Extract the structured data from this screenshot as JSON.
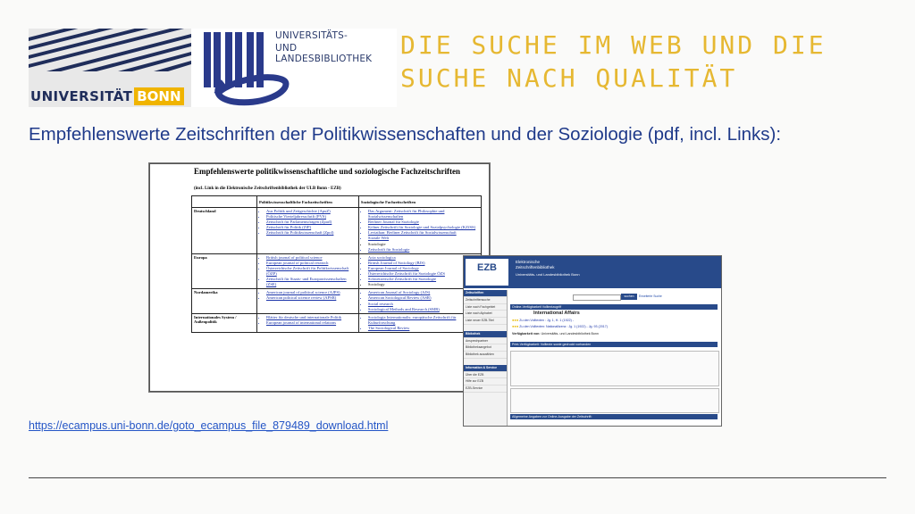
{
  "logos": {
    "university": {
      "word1": "UNIVERSITÄT",
      "word2": "BONN"
    },
    "library": {
      "line1": "UNIVERSITÄTS-",
      "line2": "UND LANDESBIBLIOTHEK"
    }
  },
  "slide": {
    "title": "Die Suche im Web und die Suche nach Qualität",
    "subtitle": "Empfehlenswerte Zeitschriften der Politikwissenschaften und der Soziologie (pdf, incl. Links):",
    "link": "https://ecampus.uni-bonn.de/goto_ecampus_file_879489_download.html"
  },
  "document": {
    "heading": "Empfehlenswerte politikwissenschaftliche und soziologische Fachzeitschriften",
    "subheading": "(incl. Link in die Elektronische Zeitschriftenbibliothek der ULB Bonn - EZB)",
    "columns": [
      "",
      "Politikwissenschaftliche Fachzeitschriften",
      "Soziologische Fachzeitschriften"
    ],
    "rows": [
      {
        "region": "Deutschland",
        "politics": [
          "Aus Politik und Zeitgeschichte (ApuZ)",
          "Politische Vierteljahresschrift (PVS)",
          "Zeitschrift für Parlamentsfragen (ZparI)",
          "Zeitschrift für Politik (ZfP)",
          "Zeitschrift für Politikwissenschaft (Zpol)"
        ],
        "sociology": [
          "Das Argument: Zeitschrift für Philosophie und Sozialwissenschaften",
          "Berliner Journal für Soziologie",
          "Kölner Zeitschrift für Soziologie und Sozialpsychologie (KZfSS)",
          "Leviathan: Berliner Zeitschrift für Sozialwissenschaft",
          "Soziale Welt",
          "Soziologie",
          "Zeitschrift für Soziologie"
        ]
      },
      {
        "region": "Europa",
        "politics": [
          "British journal of political science",
          "European journal of political research",
          "Österreichische Zeitschrift für Politikwissenschaft (ÖZP)",
          "Zeitschrift für Staats- und Europawissenschaften (ZSE)"
        ],
        "sociology": [
          "Acta sociologica",
          "British Journal of Sociology (BJS)",
          "European Journal of Sociology",
          "Österreichische Zeitschrift für Soziologie ÖZS",
          "Schweizerische Zeitschrift für Soziologie",
          "Sociology"
        ]
      },
      {
        "region": "Nordamerika",
        "politics": [
          "American journal of political science (AJPS)",
          "American political science review (APSR)"
        ],
        "sociology": [
          "American Journal of Sociology (AJS)",
          "American Sociological Review (ASR)",
          "Social research",
          "Sociological Methods and Research (SMR)"
        ]
      },
      {
        "region": "Internationales System / Außenpolitik",
        "politics": [
          "Blätter für deutsche und internationale Politik",
          "European journal of international relations"
        ],
        "sociology": [
          "Sociologia Internationalis: europäische Zeitschrift für Kulturforschung",
          "The Sociological Review"
        ]
      }
    ]
  },
  "ezb": {
    "logo": "EZB",
    "title_line1": "Elektronische",
    "title_line2": "Zeitschriftenbibliothek",
    "institution": "Universitäts- und Landesbibliothek Bonn",
    "search_button": "suchen",
    "search_advanced": "Erweiterte Suche",
    "sidebar": {
      "sections": [
        {
          "heading": "Zeitschriften",
          "items": [
            "Zeitschriftensuche",
            "Liste nach Fachgebiet",
            "Liste nach Alphabet",
            "Liste neuer EZB-Titel"
          ]
        },
        {
          "heading": "Bibliothek",
          "items": [
            "Ansprechpartner",
            "Bibliotheksangebot",
            "Bibliothek auswählen"
          ]
        },
        {
          "heading": "Information & Service",
          "items": [
            "Über die EZB",
            "Hilfe zur EZB",
            "EZB-Service"
          ]
        }
      ]
    },
    "bar1": "Online-Verfügbarkeit Volltextzugriff",
    "journal": "International Affairs",
    "row1": "Zu den Volltexten : Jg. 1, H. 1 (1922) -",
    "row2": "Zu den Volltexten: Nationallizenz : Jg. 1 (1922) - Jg. 93 (2017)",
    "row3_label": "Verfügbarkeit von:",
    "row3_text": "Universitäts- und Landesbibliothek Bonn",
    "bar2": "Print-Verfügbarkeit: Volltexte sowie gedruckt vorhanden",
    "bar3": "Allgemeine Angaben zur Online-Ausgabe der Zeitschrift:"
  }
}
